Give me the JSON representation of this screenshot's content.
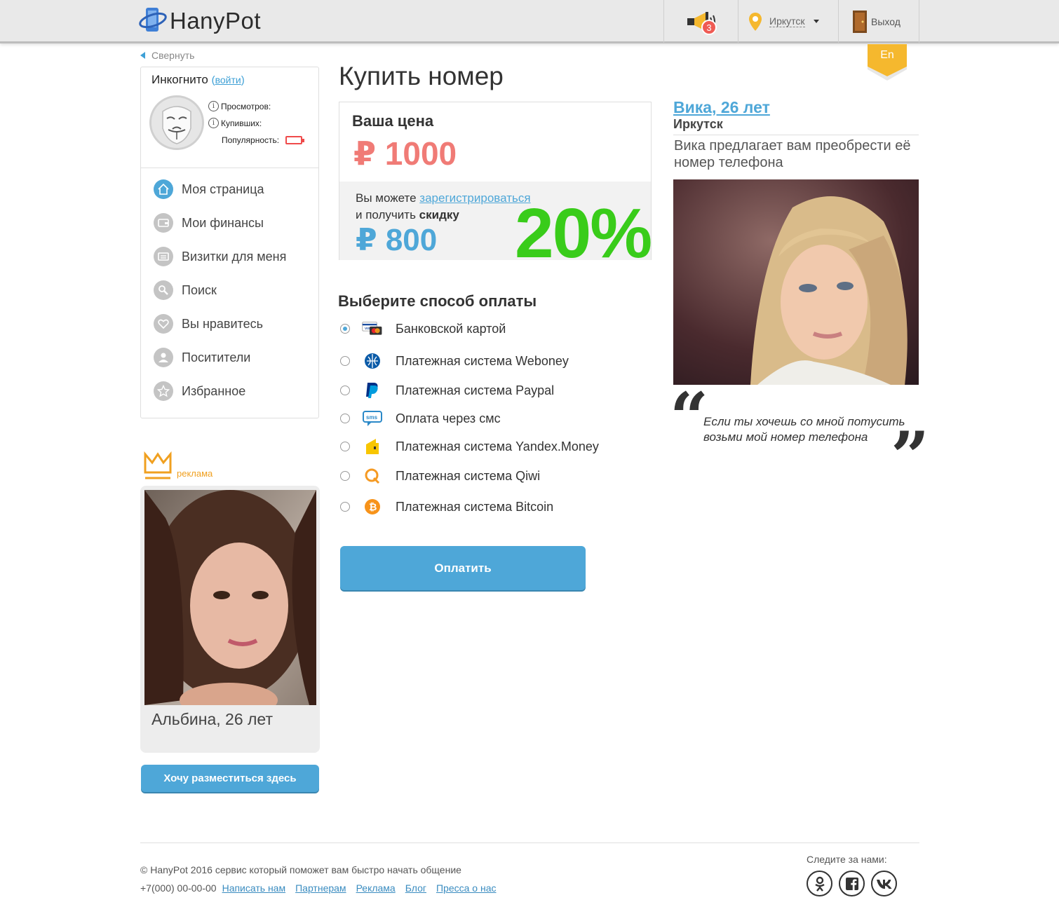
{
  "header": {
    "logo_text": "HanyPot",
    "notifications_count": "3",
    "city": "Иркутск",
    "exit_label": "Выход",
    "lang": "En"
  },
  "sidebar": {
    "collapse_label": "Свернуть",
    "profile_name": "Инкогнито",
    "login_open": "(",
    "login_link": "войти",
    "login_close": ")",
    "stats": {
      "views_label": "Просмотров:",
      "buyers_label": "Купивших:",
      "popularity_label": "Популярность:"
    },
    "menu": [
      {
        "label": "Моя страница",
        "icon": "home-icon"
      },
      {
        "label": "Мои финансы",
        "icon": "wallet-icon"
      },
      {
        "label": "Визитки для меня",
        "icon": "card-icon"
      },
      {
        "label": "Поиск",
        "icon": "search-icon"
      },
      {
        "label": "Вы нравитесь",
        "icon": "heart-icon"
      },
      {
        "label": "Поситители",
        "icon": "user-icon"
      },
      {
        "label": "Избранное",
        "icon": "star-icon"
      }
    ],
    "ad_label": "реклама",
    "ad_name": "Альбина, 26 лет",
    "ad_button": "Хочу разместиться здесь"
  },
  "main": {
    "title": "Купить номер",
    "your_price_label": "Ваша цена",
    "price": "₽ 1000",
    "discount_text_1": "Вы можете",
    "discount_link": "зарегистрироваться",
    "discount_text_2": "и получить",
    "discount_bold": "скидку",
    "discount_price": "₽ 800",
    "discount_percent": "20%",
    "payment_title": "Выберите способ оплаты",
    "payment_methods": [
      {
        "label": "Банковской картой",
        "icon": "visa-mastercard-icon",
        "selected": true
      },
      {
        "label": "Платежная система Weboney",
        "icon": "webmoney-icon",
        "selected": false
      },
      {
        "label": "Платежная система Paypal",
        "icon": "paypal-icon",
        "selected": false
      },
      {
        "label": "Оплата через смс",
        "icon": "sms-icon",
        "selected": false
      },
      {
        "label": "Платежная система Yandex.Money",
        "icon": "yandex-money-icon",
        "selected": false
      },
      {
        "label": "Платежная система Qiwi",
        "icon": "qiwi-icon",
        "selected": false
      },
      {
        "label": "Платежная система Bitcoin",
        "icon": "bitcoin-icon",
        "selected": false
      }
    ],
    "pay_button": "Оплатить"
  },
  "girl": {
    "name": "Вика, 26 лет",
    "city": "Иркутск",
    "offer": "Вика предлагает вам преобрести её номер телефона",
    "quote": "Если ты хочешь со мной потусить возьми мой номер телефона"
  },
  "footer": {
    "copyright": "© HanyPot 2016 сервис который поможет вам быстро начать общение",
    "phone": "+7(000) 00-00-00",
    "links": [
      "Написать нам",
      "Партнерам",
      "Реклама",
      "Блог",
      "Пресса о нас"
    ],
    "follow_label": "Следите за нами:",
    "socials": [
      "odnoklassniki-icon",
      "facebook-icon",
      "vk-icon"
    ]
  },
  "colors": {
    "accent": "#4ea7d8",
    "price_red": "#f07b76",
    "discount_green": "#39cc1a",
    "ad_orange": "#f0a020",
    "lang_flag": "#f5b82e"
  }
}
